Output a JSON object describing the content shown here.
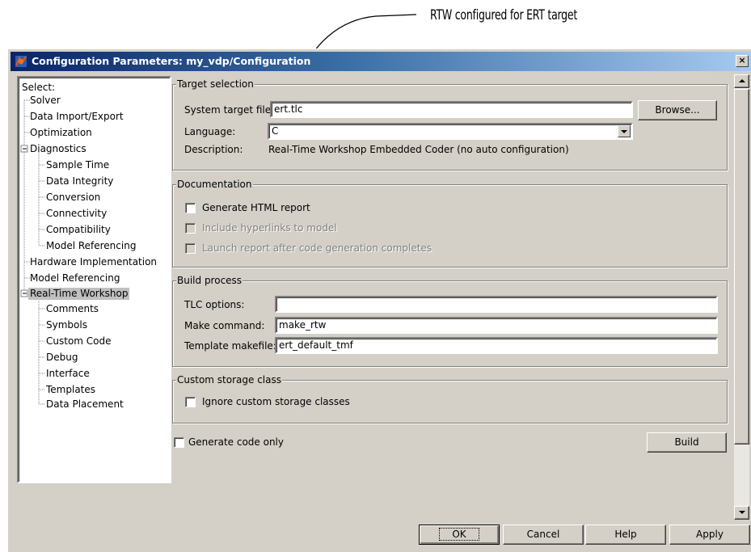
{
  "annotation": {
    "text": "RTW configured for ERT target"
  },
  "window": {
    "title": "Configuration Parameters: my_vdp/Configuration",
    "close_label": "×"
  },
  "tree": {
    "header": "Select:",
    "items": [
      {
        "label": "Solver",
        "level": 1
      },
      {
        "label": "Data Import/Export",
        "level": 1
      },
      {
        "label": "Optimization",
        "level": 1
      },
      {
        "label": "Diagnostics",
        "level": 1
      },
      {
        "label": "Sample Time",
        "level": 2
      },
      {
        "label": "Data Integrity",
        "level": 2
      },
      {
        "label": "Conversion",
        "level": 2
      },
      {
        "label": "Connectivity",
        "level": 2
      },
      {
        "label": "Compatibility",
        "level": 2
      },
      {
        "label": "Model Referencing",
        "level": 2
      },
      {
        "label": "Hardware Implementation",
        "level": 1
      },
      {
        "label": "Model Referencing",
        "level": 1
      },
      {
        "label": "Real-Time Workshop",
        "level": 1,
        "selected": true
      },
      {
        "label": "Comments",
        "level": 2
      },
      {
        "label": "Symbols",
        "level": 2
      },
      {
        "label": "Custom Code",
        "level": 2
      },
      {
        "label": "Debug",
        "level": 2
      },
      {
        "label": "Interface",
        "level": 2
      },
      {
        "label": "Templates",
        "level": 2
      },
      {
        "label": "Data Placement",
        "level": 2
      }
    ]
  },
  "target_selection": {
    "title": "Target selection",
    "system_target_file_label": "System target file:",
    "system_target_file_value": "ert.tlc",
    "browse_label": "Browse...",
    "language_label": "Language:",
    "language_value": "C",
    "description_label": "Description:",
    "description_value": "Real-Time Workshop Embedded Coder (no auto configuration)"
  },
  "documentation": {
    "title": "Documentation",
    "generate_html_label": "Generate HTML report",
    "include_hyperlinks_label": "Include hyperlinks to model",
    "launch_report_label": "Launch report after code generation completes"
  },
  "build_process": {
    "title": "Build process",
    "tlc_options_label": "TLC options:",
    "tlc_options_value": "",
    "make_command_label": "Make command:",
    "make_command_value": "make_rtw",
    "template_makefile_label": "Template makefile:",
    "template_makefile_value": "ert_default_tmf"
  },
  "custom_storage": {
    "title": "Custom storage class",
    "ignore_label": "Ignore custom storage classes"
  },
  "generate_code_only_label": "Generate code only",
  "build_label": "Build",
  "footer": {
    "ok_label": "OK",
    "cancel_label": "Cancel",
    "help_label": "Help",
    "apply_label": "Apply"
  }
}
